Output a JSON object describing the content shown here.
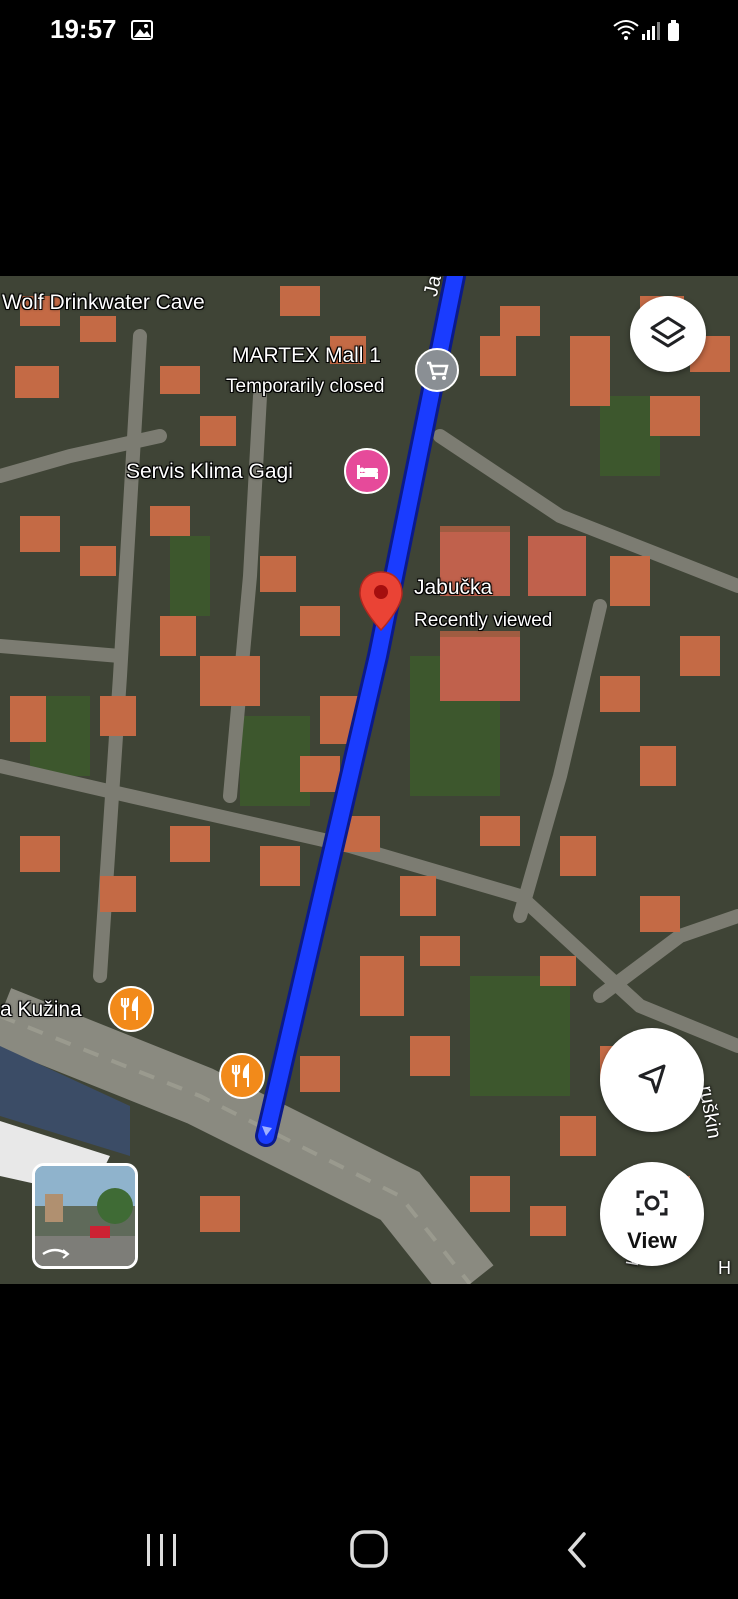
{
  "status_bar": {
    "time": "19:57",
    "icons": [
      "gallery-icon",
      "wifi-icon",
      "signal-icon",
      "battery-icon"
    ]
  },
  "map": {
    "labels": {
      "wolf_cave": "Wolf Drinkwater Cave",
      "martex_name": "MARTEX Mall 1",
      "martex_status": "Temporarily closed",
      "servis": "Servis Klima Gagi",
      "jabucka_name": "Jabučka",
      "jabucka_status": "Recently viewed",
      "kuzina": "a Kužina",
      "street_top": "Jabu",
      "street_right": "ruškin",
      "street_bottom_k": "K",
      "street_bottom_h": "H"
    },
    "pois": [
      {
        "name": "MARTEX Mall 1",
        "type": "shopping-cart-icon",
        "color": "#8a8f94"
      },
      {
        "name": "Servis Klima Gagi",
        "type": "hotel-bed-icon",
        "color": "#e64a9a"
      },
      {
        "name": "Jabučka",
        "type": "map-pin-icon",
        "color": "#ea4335"
      },
      {
        "name": "a Kužina",
        "type": "restaurant-icon",
        "color": "#f28a1a"
      },
      {
        "name": "restaurant",
        "type": "restaurant-icon",
        "color": "#f28a1a"
      }
    ],
    "route_color": "#1a3cff",
    "view_button_label": "View",
    "controls": [
      "layers-icon",
      "navigation-arrow-icon",
      "lens-camera-icon"
    ]
  },
  "nav_bar": {
    "buttons": [
      "recent-apps-icon",
      "home-icon",
      "back-icon"
    ]
  }
}
